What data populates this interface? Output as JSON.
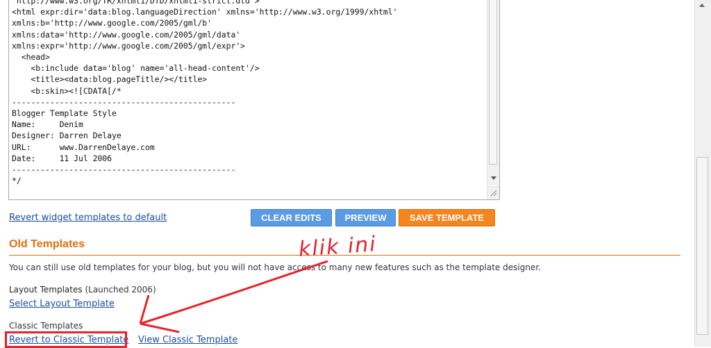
{
  "editor": {
    "code": "\"http://www.w3.org/TR/xhtml1/DTD/xhtml1-strict.dtd\">\n<html expr:dir='data:blog.languageDirection' xmlns='http://www.w3.org/1999/xhtml'\nxmlns:b='http://www.google.com/2005/gml/b'\nxmlns:data='http://www.google.com/2005/gml/data'\nxmlns:expr='http://www.google.com/2005/gml/expr'>\n  <head>\n    <b:include data='blog' name='all-head-content'/>\n    <title><data:blog.pageTitle/></title>\n    <b:skin><![CDATA[/*\n-----------------------------------------------\nBlogger Template Style\nName:     Denim\nDesigner: Darren Delaye\nURL:      www.DarrenDelaye.com\nDate:     11 Jul 2006\n-----------------------------------------------\n*/"
  },
  "actions": {
    "revert_widget_label": "Revert widget templates to default",
    "clear_edits_label": "CLEAR EDITS",
    "preview_label": "PREVIEW",
    "save_label": "SAVE TEMPLATE"
  },
  "old_templates": {
    "title": "Old Templates",
    "description": "You can still use old templates for your blog, but you will not have access to many new features such as the template designer.",
    "layout_heading": "Layout Templates",
    "layout_launched": "(Launched 2006)",
    "layout_link": "Select Layout Template",
    "classic_heading": "Classic Templates",
    "revert_classic_link": "Revert to Classic Template",
    "view_classic_link": "View Classic Template"
  },
  "annotation": {
    "text": "klik ini",
    "color": "#e8202a"
  },
  "colors": {
    "accent_orange": "#e06f0e",
    "button_blue": "#5a9be4",
    "button_orange": "#f4851f",
    "link_blue": "#1a4ea0"
  }
}
